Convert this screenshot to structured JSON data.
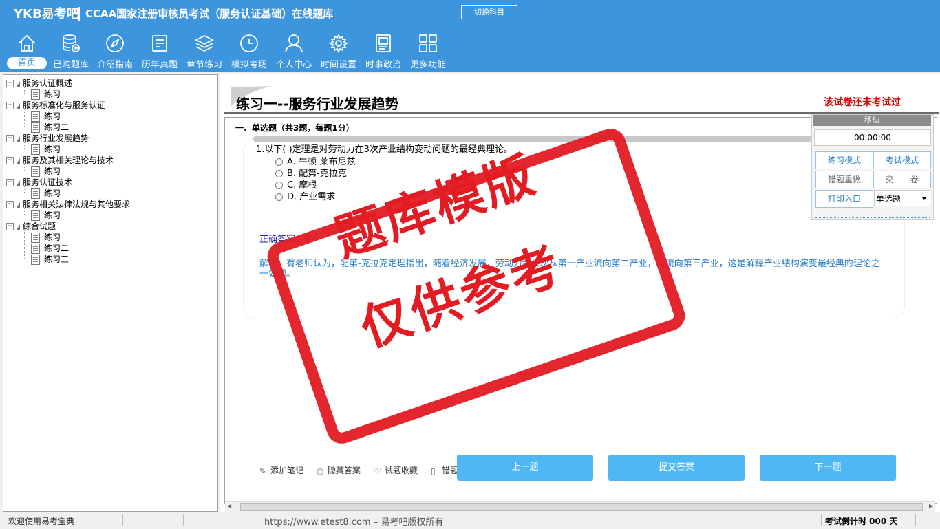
{
  "header": {
    "brand": "YKB易考吧",
    "app_title": "CCAA国家注册审核员考试（服务认证基础）在线题库",
    "switch_subject": "切换科目"
  },
  "nav": [
    {
      "label": "首页",
      "icon": "home-icon"
    },
    {
      "label": "已购题库",
      "icon": "database-icon"
    },
    {
      "label": "介绍指南",
      "icon": "compass-icon"
    },
    {
      "label": "历年真题",
      "icon": "document-list-icon"
    },
    {
      "label": "章节练习",
      "icon": "layers-icon"
    },
    {
      "label": "模拟考场",
      "icon": "clock-icon"
    },
    {
      "label": "个人中心",
      "icon": "user-icon"
    },
    {
      "label": "时间设置",
      "icon": "gear-icon"
    },
    {
      "label": "时事政治",
      "icon": "notebook-icon"
    },
    {
      "label": "更多功能",
      "icon": "grid-icon"
    }
  ],
  "tree": [
    {
      "label": "服务认证概述",
      "children": [
        "练习一"
      ]
    },
    {
      "label": "服务标准化与服务认证",
      "children": [
        "练习一",
        "练习二"
      ]
    },
    {
      "label": "服务行业发展趋势",
      "children": [
        "练习一"
      ]
    },
    {
      "label": "服务及其相关理论与技术",
      "children": [
        "练习一"
      ]
    },
    {
      "label": "服务认证技术",
      "children": [
        "练习一"
      ]
    },
    {
      "label": "服务相关法律法规与其他要求",
      "children": [
        "练习一"
      ]
    },
    {
      "label": "综合试题",
      "children": [
        "练习一",
        "练习二",
        "练习三"
      ]
    }
  ],
  "exercise": {
    "title": "练习一--服务行业发展趋势",
    "status": "该试卷还未考试过",
    "section_title": "一、单选题（共3题，每题1分）",
    "question": "1.以下(  )定理是对劳动力在3次产业结构变动问题的最经典理论。",
    "options": [
      "A. 牛顿-莱布尼兹",
      "B. 配第-克拉克",
      "C. 摩根",
      "D. 产业需求"
    ],
    "answer": "正确答案：B",
    "analysis": "解析：有老师认为，配第-克拉克定理指出，随着经济发展，劳动力会依次从第一产业流向第二产业，再流向第三产业，这是解释产业结构演变最经典的理论之一如题。"
  },
  "side": {
    "move": "移动",
    "timer": "00:00:00",
    "practice_mode": "练习模式",
    "exam_mode": "考试模式",
    "redo_wrong": "错题重做",
    "hand_in": "交　　卷",
    "print_entry": "打印入口",
    "question_type": "单选题"
  },
  "toolbar": {
    "add_note": "添加笔记",
    "hide_answer": "隐藏答案",
    "favorite": "试题收藏",
    "wrong": "错题",
    "prev": "上一题",
    "submit": "提交答案",
    "next": "下一题"
  },
  "statusbar": {
    "welcome": "欢迎使用易考宝典",
    "copyright": "https://www.etest8.com – 易考吧版权所有",
    "countdown": "考试倒计时 000 天"
  },
  "watermark": {
    "line1": "题库模版",
    "line2": "仅供参考"
  },
  "colors": {
    "header": "#3d95dd",
    "button": "#4fb8f4",
    "stamp": "#e31b23",
    "status": "#d10000"
  }
}
